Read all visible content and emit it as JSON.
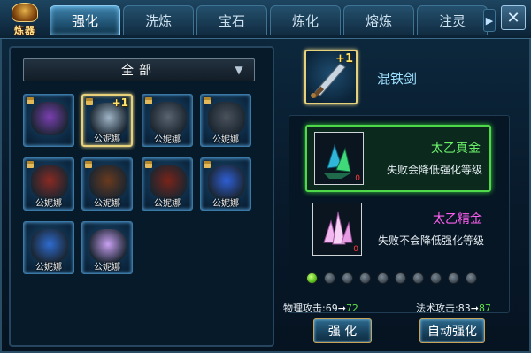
{
  "logo": {
    "text": "炼器",
    "icon": "forge-emblem-icon"
  },
  "tabs": [
    {
      "label": "强化",
      "active": true
    },
    {
      "label": "洗炼",
      "active": false
    },
    {
      "label": "宝石",
      "active": false
    },
    {
      "label": "炼化",
      "active": false
    },
    {
      "label": "熔炼",
      "active": false
    },
    {
      "label": "注灵",
      "active": false
    }
  ],
  "tab_scroll_icon": "▶",
  "close_icon": "✕",
  "inventory": {
    "filter_label": "全部",
    "filter_arrow": "▼",
    "items": [
      {
        "name": "amulet",
        "owner": "",
        "plus": "",
        "locked": true,
        "selected": false,
        "accent": "#7a3fb0"
      },
      {
        "name": "sword",
        "owner": "公妮娜",
        "plus": "+1",
        "locked": true,
        "selected": true,
        "accent": "#9fb5c7"
      },
      {
        "name": "shoulder-armor",
        "owner": "公妮娜",
        "plus": "",
        "locked": true,
        "selected": false,
        "accent": "#5a6470"
      },
      {
        "name": "chest-armor",
        "owner": "公妮娜",
        "plus": "",
        "locked": true,
        "selected": false,
        "accent": "#4a525c"
      },
      {
        "name": "gauntlet",
        "owner": "公妮娜",
        "plus": "",
        "locked": true,
        "selected": false,
        "accent": "#8a2a22"
      },
      {
        "name": "leg-armor",
        "owner": "公妮娜",
        "plus": "",
        "locked": true,
        "selected": false,
        "accent": "#6a3a1e"
      },
      {
        "name": "boots",
        "owner": "公妮娜",
        "plus": "",
        "locked": true,
        "selected": false,
        "accent": "#7a2418"
      },
      {
        "name": "necklace",
        "owner": "公妮娜",
        "plus": "",
        "locked": true,
        "selected": false,
        "accent": "#2f5fd6"
      },
      {
        "name": "ring",
        "owner": "公妮娜",
        "plus": "",
        "locked": false,
        "selected": false,
        "accent": "#2f6cd0"
      },
      {
        "name": "crystal-blade",
        "owner": "公妮娜",
        "plus": "",
        "locked": false,
        "selected": false,
        "accent": "#c9a0f2"
      }
    ]
  },
  "equipped": {
    "name": "混铁剑",
    "plus": "+1"
  },
  "materials": [
    {
      "name": "太乙真金",
      "desc": "失败会降低强化等级",
      "count": "0",
      "color": "#6cf06a",
      "gem": "#2fb6d8",
      "active": true
    },
    {
      "name": "太乙精金",
      "desc": "失败不会降低强化等级",
      "count": "0",
      "color": "#ff5ff0",
      "gem": "#f2b7ee",
      "active": false
    }
  ],
  "level_dots": {
    "total": 10,
    "filled": 1
  },
  "stats": {
    "physical": {
      "label": "物理攻击:",
      "from": "69",
      "arrow": "➞",
      "to": "72"
    },
    "magic": {
      "label": "法术攻击:",
      "from": "83",
      "arrow": "➞",
      "to": "87"
    }
  },
  "buttons": {
    "enhance": "强 化",
    "auto_enhance": "自动强化"
  }
}
